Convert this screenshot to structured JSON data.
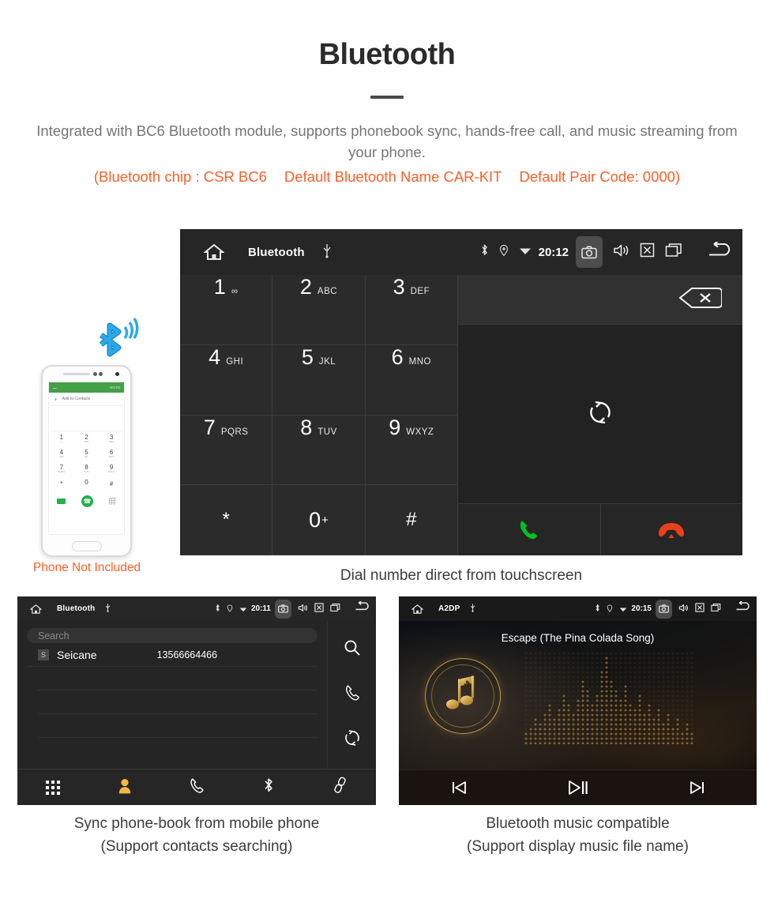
{
  "header": {
    "title": "Bluetooth",
    "subtitle": "Integrated with BC6 Bluetooth module, supports phonebook sync, hands-free call, and music streaming from your phone.",
    "spec_chip": "(Bluetooth chip : CSR BC6",
    "spec_name": "Default Bluetooth Name CAR-KIT",
    "spec_pair": "Default Pair Code: 0000)",
    "accent_color": "#f4622a",
    "body_color": "#757575"
  },
  "main_screen": {
    "status": {
      "title": "Bluetooth",
      "time": "20:12",
      "icons": [
        "home-icon",
        "usb-icon",
        "bluetooth-icon",
        "location-icon",
        "wifi-icon",
        "camera-icon",
        "volume-icon",
        "close-icon",
        "recents-icon",
        "back-icon"
      ]
    },
    "keys": [
      {
        "num": "1",
        "sub": "∞",
        "sup": ""
      },
      {
        "num": "2",
        "sub": "ABC",
        "sup": ""
      },
      {
        "num": "3",
        "sub": "DEF",
        "sup": ""
      },
      {
        "num": "4",
        "sub": "GHI",
        "sup": ""
      },
      {
        "num": "5",
        "sub": "JKL",
        "sup": ""
      },
      {
        "num": "6",
        "sub": "MNO",
        "sup": ""
      },
      {
        "num": "7",
        "sub": "PQRS",
        "sup": ""
      },
      {
        "num": "8",
        "sub": "TUV",
        "sup": ""
      },
      {
        "num": "9",
        "sub": "WXYZ",
        "sup": ""
      },
      {
        "num": "*",
        "sub": "",
        "sup": ""
      },
      {
        "num": "0",
        "sub": "",
        "sup": "+"
      },
      {
        "num": "#",
        "sub": "",
        "sup": ""
      }
    ],
    "dial_value": "",
    "nav": [
      "dialpad-icon",
      "contacts-icon",
      "calllog-icon",
      "bluetooth-icon",
      "link-icon"
    ],
    "active_nav": 0,
    "active_color": "#f5b942",
    "call_color": "#00c21e",
    "hangup_color": "#e8401a",
    "caption": "Dial number direct from touchscreen"
  },
  "phone_mock": {
    "topbar_more": "MORE",
    "add_label": "Add to Contacts",
    "keys": [
      {
        "n": "1",
        "s": "∞"
      },
      {
        "n": "2",
        "s": "ABC"
      },
      {
        "n": "3",
        "s": "DEF"
      },
      {
        "n": "4",
        "s": "GHI"
      },
      {
        "n": "5",
        "s": "JKL"
      },
      {
        "n": "6",
        "s": "MNO"
      },
      {
        "n": "7",
        "s": "PQRS"
      },
      {
        "n": "8",
        "s": "TUV"
      },
      {
        "n": "9",
        "s": "WXYZ"
      },
      {
        "n": "*",
        "s": ""
      },
      {
        "n": "0",
        "s": "+"
      },
      {
        "n": "#",
        "s": ""
      }
    ],
    "note": "Phone Not Included",
    "note_color": "#f4622a",
    "bt_color": "#12a0e8"
  },
  "contacts_screen": {
    "status": {
      "title": "Bluetooth",
      "time": "20:11"
    },
    "search_placeholder": "Search",
    "search_value": "",
    "contacts": [
      {
        "badge": "S",
        "name": "Seicane",
        "number": "13566664466"
      }
    ],
    "side_actions": [
      "search-icon",
      "call-icon",
      "sync-icon"
    ],
    "nav": [
      "dialpad-icon",
      "contacts-icon",
      "calllog-icon",
      "bluetooth-icon",
      "link-icon"
    ],
    "active_nav": 1,
    "caption_line1": "Sync phone-book from mobile phone",
    "caption_line2": "(Support contacts searching)"
  },
  "music_screen": {
    "status": {
      "title": "A2DP",
      "time": "20:15"
    },
    "track_title": "Escape (The Pina Colada Song)",
    "controls": [
      "previous-icon",
      "play-pause-icon",
      "next-icon"
    ],
    "accent_color": "#c79a43",
    "caption_line1": "Bluetooth music compatible",
    "caption_line2": "(Support display music file name)"
  }
}
